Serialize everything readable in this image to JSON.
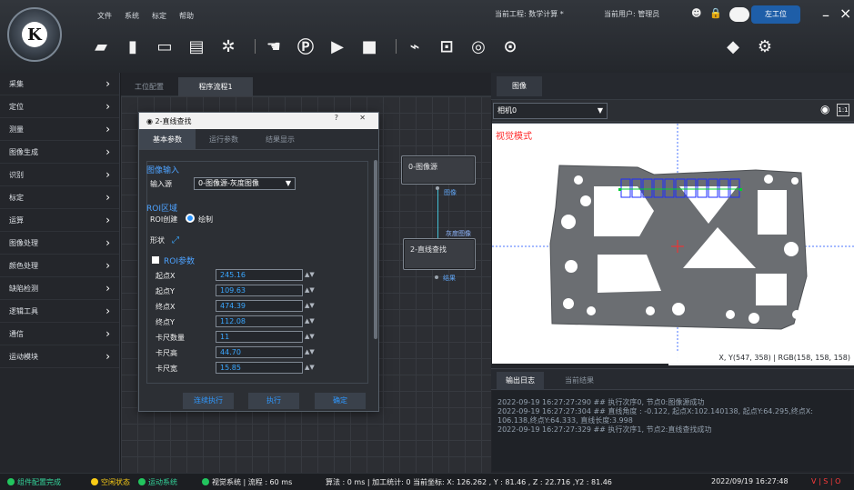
{
  "app": {
    "logo": "K"
  },
  "menu": [
    "文件",
    "系统",
    "标定",
    "帮助"
  ],
  "header": {
    "project": "当前工程: 数学计算 *",
    "user": "当前用户: 管理员",
    "station": "左工位"
  },
  "toolbar": [
    "folder-icon",
    "new-file-icon",
    "save-icon",
    "save-as-icon",
    "settings-icon",
    "|",
    "hand-icon",
    "p-icon",
    "play-icon",
    "stop-icon",
    "|",
    "chart-icon",
    "pan-icon",
    "target-icon",
    "camera-icon",
    "warning-icon",
    "gear-person-icon"
  ],
  "sidebar": [
    "采集",
    "定位",
    "测量",
    "图像生成",
    "识别",
    "标定",
    "运算",
    "图像处理",
    "颜色处理",
    "缺陷检测",
    "逻辑工具",
    "通信",
    "运动模块"
  ],
  "tabs": {
    "left": [
      "工位配置",
      "程序流程1"
    ],
    "right": [
      "图像"
    ]
  },
  "nodes": [
    {
      "title": "0-图像源",
      "port": "图像"
    },
    {
      "title": "2-直线查找",
      "port": "灰度图像",
      "port2": "结果"
    }
  ],
  "dialog": {
    "title": "◉ 2-直线查找",
    "question": "?",
    "close": "✕",
    "tabs": [
      "基本参数",
      "运行参数",
      "结果显示"
    ],
    "image_input": "图像输入",
    "input_label": "输入源",
    "input_value": "0-图像源-灰度图像",
    "roi_area": "ROI区域",
    "roi_create": "ROI创建",
    "roi_radio": "绘制",
    "shape": "形状",
    "roi_params": "ROI参数",
    "fields": [
      {
        "label": "起点X",
        "value": "245.16"
      },
      {
        "label": "起点Y",
        "value": "109.63"
      },
      {
        "label": "终点X",
        "value": "474.39"
      },
      {
        "label": "终点Y",
        "value": "112.08"
      },
      {
        "label": "卡尺数量",
        "value": "11"
      },
      {
        "label": "卡尺高",
        "value": "44.70"
      },
      {
        "label": "卡尺宽",
        "value": "15.85"
      }
    ],
    "buttons": [
      "连续执行",
      "执行",
      "确定"
    ]
  },
  "camera": {
    "select": "相机0"
  },
  "image": {
    "label": "视觉模式",
    "coords": "X, Y(547, 358) | RGB(158, 158, 158)"
  },
  "log": {
    "tabs": [
      "输出日志",
      "当前结果"
    ],
    "lines": [
      "2022-09-19 16:27:27:290 ## 执行次序0, 节点0:图像源成功",
      "2022-09-19 16:27:27:304 ## 直线角度 : -0.122, 起点X:102.140138, 起点Y:64.295,终点X:",
      "106.138,终点Y:64.333, 直线长度:3.998",
      "2022-09-19 16:27:27:329 ## 执行次序1, 节点2:直线查找成功"
    ]
  },
  "status": {
    "a": "组件配置完成",
    "b": "空闲状态",
    "c": "运动系统",
    "d": "视觉系统 | 流程 : 60 ms",
    "e": "算法 : 0 ms | 加工统计: 0  当前坐标: X: 126.262 , Y : 81.46 , Z : 22.716 ,Y2 : 81.46",
    "f": "2022/09/19 16:27:48",
    "g": "V | S | O"
  }
}
